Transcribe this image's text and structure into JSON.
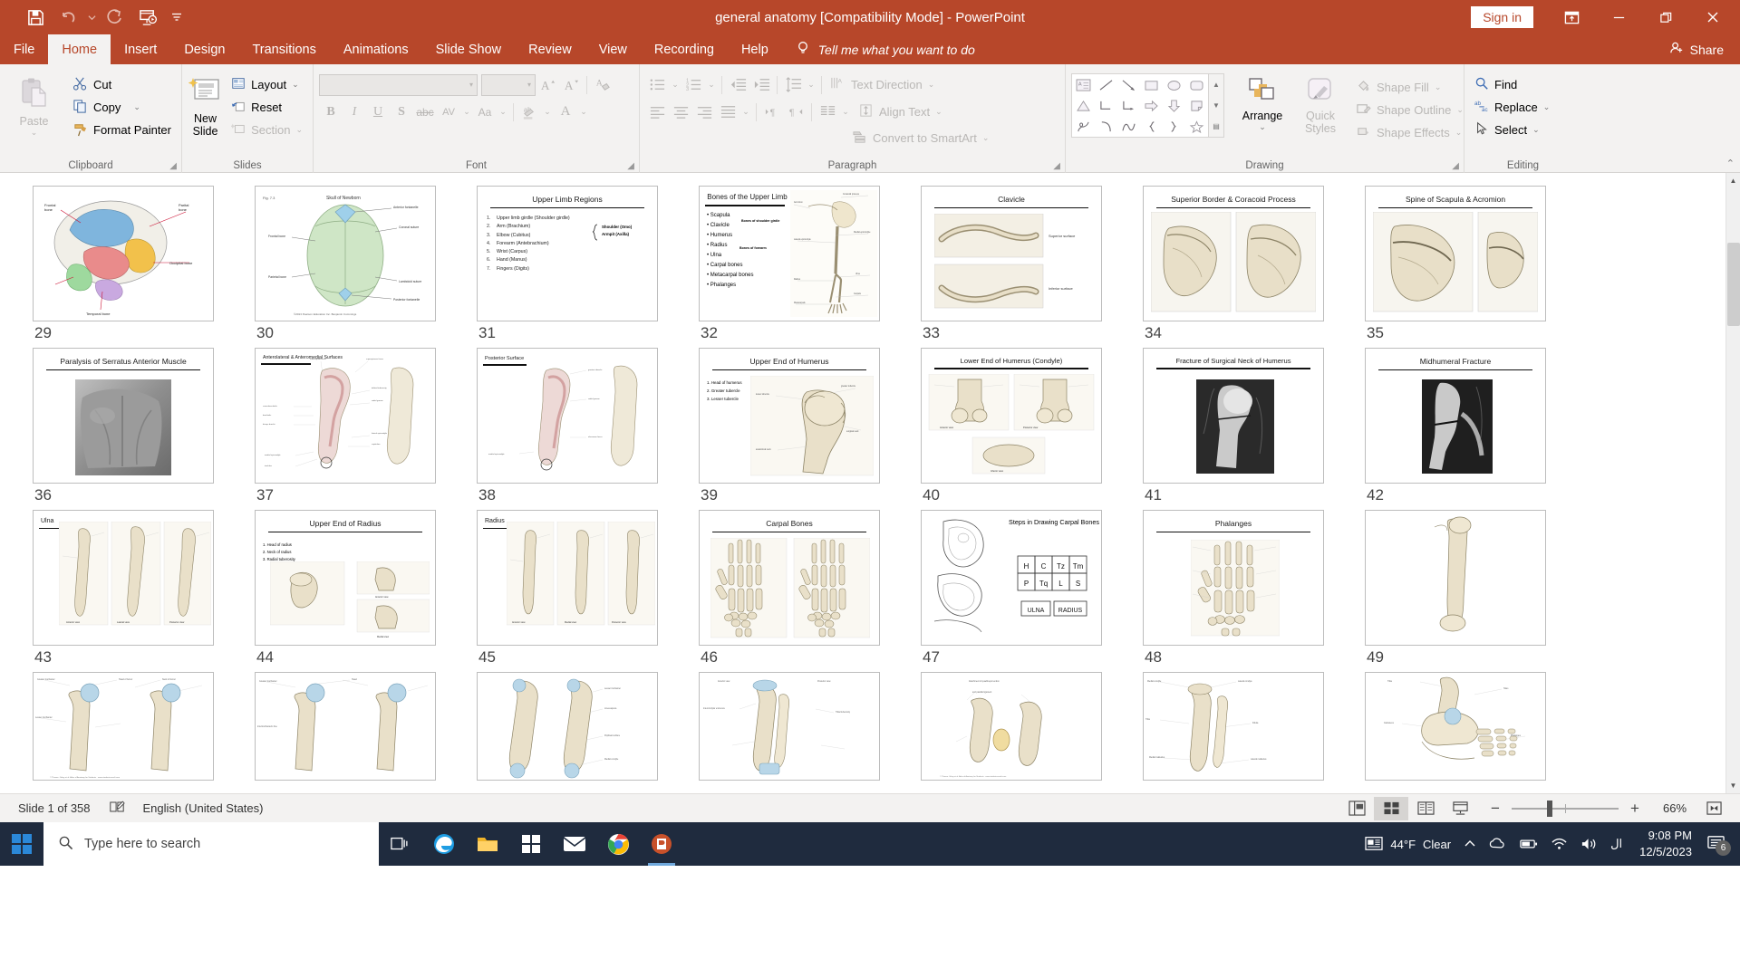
{
  "window": {
    "title": "general anatomy [Compatibility Mode]  -  PowerPoint",
    "signin_label": "Sign in",
    "share_label": "Share"
  },
  "qat": [
    {
      "name": "save-icon",
      "label": "Save"
    },
    {
      "name": "undo-icon",
      "label": "Undo"
    },
    {
      "name": "undo-dropdown-icon",
      "label": "Undo options"
    },
    {
      "name": "redo-icon",
      "label": "Redo"
    },
    {
      "name": "start-presentation-icon",
      "label": "Start From Beginning"
    },
    {
      "name": "customize-qat-icon",
      "label": "Customize Quick Access Toolbar"
    }
  ],
  "tabs": [
    {
      "label": "File",
      "active": false
    },
    {
      "label": "Home",
      "active": true
    },
    {
      "label": "Insert",
      "active": false
    },
    {
      "label": "Design",
      "active": false
    },
    {
      "label": "Transitions",
      "active": false
    },
    {
      "label": "Animations",
      "active": false
    },
    {
      "label": "Slide Show",
      "active": false
    },
    {
      "label": "Review",
      "active": false
    },
    {
      "label": "View",
      "active": false
    },
    {
      "label": "Recording",
      "active": false
    },
    {
      "label": "Help",
      "active": false
    }
  ],
  "tellme": "Tell me what you want to do",
  "ribbon": {
    "groups": [
      {
        "name": "clipboard",
        "label": "Clipboard"
      },
      {
        "name": "slides",
        "label": "Slides"
      },
      {
        "name": "font",
        "label": "Font"
      },
      {
        "name": "paragraph",
        "label": "Paragraph"
      },
      {
        "name": "drawing",
        "label": "Drawing"
      },
      {
        "name": "editing",
        "label": "Editing"
      }
    ],
    "clipboard": {
      "paste": "Paste",
      "cut": "Cut",
      "copy": "Copy",
      "format_painter": "Format Painter"
    },
    "slides": {
      "new_slide": "New\nSlide",
      "new_slide_line1": "New",
      "new_slide_line2": "Slide",
      "layout": "Layout",
      "reset": "Reset",
      "section": "Section"
    },
    "font": {
      "font_name_value": "",
      "font_size_value": "",
      "bold": "B",
      "italic": "I",
      "underline": "U",
      "shadow": "S",
      "strikethrough": "abc",
      "char_spacing": "AV",
      "change_case": "Aa"
    },
    "paragraph": {
      "text_direction": "Text Direction",
      "align_text": "Align Text",
      "convert_smartart": "Convert to SmartArt"
    },
    "drawing": {
      "arrange": "Arrange",
      "quick_styles_line1": "Quick",
      "quick_styles_line2": "Styles",
      "shape_fill": "Shape Fill",
      "shape_outline": "Shape Outline",
      "shape_effects": "Shape Effects"
    },
    "editing": {
      "find": "Find",
      "replace": "Replace",
      "select": "Select"
    }
  },
  "slides": [
    {
      "num": "29",
      "type": "image",
      "title": "",
      "variant": "skull-colored"
    },
    {
      "num": "30",
      "type": "image",
      "title": "",
      "variant": "skull-superior"
    },
    {
      "num": "31",
      "type": "list",
      "title": "Upper Limb Regions",
      "items": [
        "Upper limb girdle (Shoulder girdle)",
        "Arm (Brachium)",
        "Elbow (Cubitus)",
        "Forearm (Antebrachium)",
        "Wrist (Carpus)",
        "Hand (Manus)",
        "Fingers (Digits)"
      ],
      "annotations": [
        "Shoulder (Omo)",
        "Armpit (Axilla)"
      ]
    },
    {
      "num": "32",
      "type": "bullets",
      "title": "Bones of the Upper Limb",
      "items": [
        "Scapula",
        "Clavicle",
        "Humerus",
        "Radius",
        "Ulna",
        "Carpal bones",
        "Metacarpal bones",
        "Phalanges"
      ],
      "annotations": [
        "Bones of shoulder girdle",
        "Bones of forearm"
      ]
    },
    {
      "num": "33",
      "type": "figure",
      "title": "Clavicle",
      "labels": [
        "Superior surface",
        "Inferior surface"
      ]
    },
    {
      "num": "34",
      "type": "figure",
      "title": "Superior Border & Coracoid Process",
      "labels": []
    },
    {
      "num": "35",
      "type": "figure",
      "title": "Spine of Scapula & Acromion",
      "labels": []
    },
    {
      "num": "36",
      "type": "figure",
      "title": "Paralysis of Serratus Anterior Muscle",
      "labels": []
    },
    {
      "num": "37",
      "type": "figure",
      "title": "Anterolateral & Anteromedial Surfaces",
      "labels": []
    },
    {
      "num": "38",
      "type": "figure",
      "title": "Posterior Surface",
      "labels": []
    },
    {
      "num": "39",
      "type": "figure",
      "title": "Upper End of Humerus",
      "labels": [
        "1. Head of humerus",
        "2. Greater tubercle",
        "3. Lesser tubercle"
      ]
    },
    {
      "num": "40",
      "type": "figure",
      "title": "Lower End of Humerus (Condyle)",
      "labels": [
        "Anterior view",
        "Posterior view",
        "Inferior view"
      ]
    },
    {
      "num": "41",
      "type": "figure",
      "title": "Fracture of Surgical Neck of Humerus",
      "labels": []
    },
    {
      "num": "42",
      "type": "figure",
      "title": "Midhumeral Fracture",
      "labels": []
    },
    {
      "num": "43",
      "type": "figure",
      "title": "Ulna",
      "labels": [
        "Anterior view",
        "Lateral view",
        "Posterior view"
      ]
    },
    {
      "num": "44",
      "type": "figure",
      "title": "Upper End of Radius",
      "labels": [
        "1. Head of radius",
        "2. Neck of radius",
        "3. Radial tuberosity"
      ]
    },
    {
      "num": "45",
      "type": "figure",
      "title": "Radius",
      "labels": [
        "Anterior view",
        "Medial view",
        "Posterior view"
      ]
    },
    {
      "num": "46",
      "type": "figure",
      "title": "Carpal Bones",
      "labels": []
    },
    {
      "num": "47",
      "type": "figure",
      "title": "Steps in Drawing Carpal Bones",
      "labels": [
        "H",
        "C",
        "Tz",
        "Tm",
        "P",
        "Tq",
        "L",
        "S",
        "ULNA",
        "RADIUS"
      ]
    },
    {
      "num": "48",
      "type": "figure",
      "title": "Phalanges",
      "labels": []
    },
    {
      "num": "49",
      "type": "figure",
      "title": "",
      "labels": []
    },
    {
      "num": "",
      "type": "figure",
      "title": "",
      "labels": []
    },
    {
      "num": "",
      "type": "figure",
      "title": "",
      "labels": []
    },
    {
      "num": "",
      "type": "figure",
      "title": "",
      "labels": []
    },
    {
      "num": "",
      "type": "figure",
      "title": "",
      "labels": []
    },
    {
      "num": "",
      "type": "figure",
      "title": "",
      "labels": []
    },
    {
      "num": "",
      "type": "figure",
      "title": "",
      "labels": []
    },
    {
      "num": "",
      "type": "figure",
      "title": "",
      "labels": []
    }
  ],
  "status": {
    "slide_counter": "Slide 1 of 358",
    "language": "English (United States)",
    "zoom_level": "66%",
    "views": [
      {
        "name": "normal-view-button",
        "label": "Normal",
        "active": false
      },
      {
        "name": "slide-sorter-view-button",
        "label": "Slide Sorter",
        "active": true
      },
      {
        "name": "reading-view-button",
        "label": "Reading View",
        "active": false
      },
      {
        "name": "slide-show-button",
        "label": "Slide Show",
        "active": false
      }
    ],
    "zoom_out_label": "−",
    "zoom_in_label": "+",
    "fit_label": "Fit slide to current window"
  },
  "taskbar": {
    "search_placeholder": "Type here to search",
    "weather_temp": "44°F",
    "weather_cond": "Clear",
    "time": "9:08 PM",
    "date": "12/5/2023",
    "notification_count": "6",
    "apps": [
      {
        "name": "task-view-icon",
        "label": "Task View"
      },
      {
        "name": "edge-icon",
        "label": "Microsoft Edge"
      },
      {
        "name": "file-explorer-icon",
        "label": "File Explorer"
      },
      {
        "name": "microsoft-store-icon",
        "label": "Microsoft Store"
      },
      {
        "name": "mail-icon",
        "label": "Mail"
      },
      {
        "name": "chrome-icon",
        "label": "Google Chrome"
      },
      {
        "name": "powerpoint-icon",
        "label": "PowerPoint"
      }
    ]
  },
  "colors": {
    "accent": "#b7472a",
    "ribbon_bg": "#f3f2f1",
    "taskbar_bg": "#1f2b3e"
  }
}
